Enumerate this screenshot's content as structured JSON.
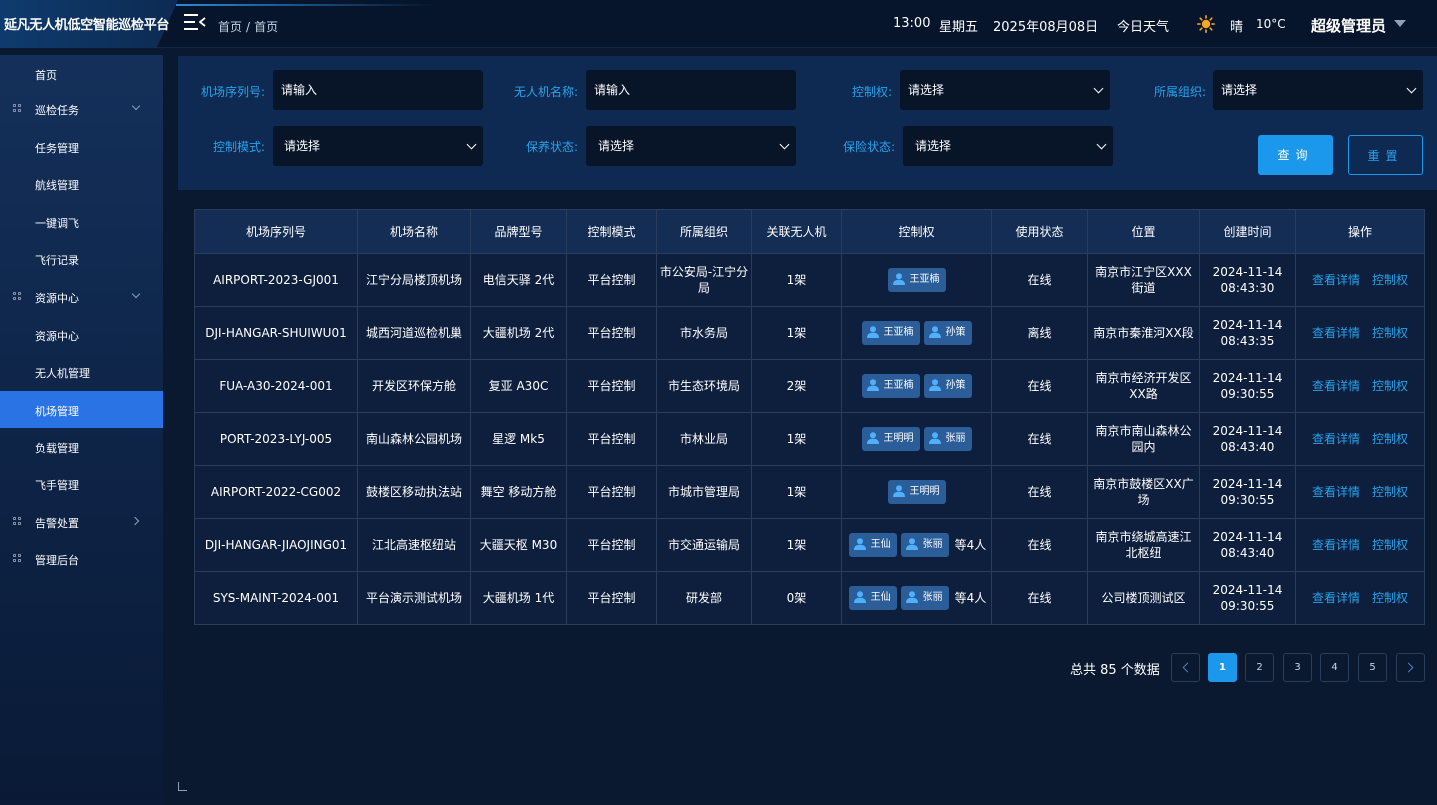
{
  "app": {
    "title": "延凡无人机低空智能巡检平台"
  },
  "breadcrumb": [
    "首页",
    "首页"
  ],
  "header": {
    "time": "13:00",
    "weekday": "星期五",
    "date": "2025年08月08日",
    "weather_label": "今日天气",
    "weather": "晴",
    "temp": "10°C",
    "user": "超级管理员"
  },
  "sidebar": {
    "items": [
      {
        "label": "首页",
        "level": 1
      },
      {
        "label": "巡检任务",
        "level": 0,
        "icon": "grid-icon",
        "chevron": "down"
      },
      {
        "label": "任务管理",
        "level": 1
      },
      {
        "label": "航线管理",
        "level": 1
      },
      {
        "label": "一键调飞",
        "level": 1
      },
      {
        "label": "飞行记录",
        "level": 1
      },
      {
        "label": "资源中心",
        "level": 0,
        "icon": "grid-icon",
        "chevron": "down"
      },
      {
        "label": "资源中心",
        "level": 1
      },
      {
        "label": "无人机管理",
        "level": 1
      },
      {
        "label": "机场管理",
        "level": 1,
        "active": true
      },
      {
        "label": "负载管理",
        "level": 1
      },
      {
        "label": "飞手管理",
        "level": 1
      },
      {
        "label": "告警处置",
        "level": 0,
        "icon": "grid-icon",
        "chevron": "right"
      },
      {
        "label": "管理后台",
        "level": 0,
        "icon": "grid-icon"
      }
    ]
  },
  "filters": {
    "serial": {
      "label": "机场序列号:",
      "placeholder": "请输入"
    },
    "drone_name": {
      "label": "无人机名称:",
      "placeholder": "请输入"
    },
    "control": {
      "label": "控制权:",
      "value": "请选择"
    },
    "org": {
      "label": "所属组织:",
      "value": "请选择"
    },
    "mode": {
      "label": "控制模式:",
      "value": "请选择"
    },
    "maintain": {
      "label": "保养状态:",
      "value": "请选择"
    },
    "insurance": {
      "label": "保险状态:",
      "value": "请选择"
    },
    "query_label": "查询",
    "reset_label": "重置"
  },
  "table": {
    "columns": [
      "机场序列号",
      "机场名称",
      "品牌型号",
      "控制模式",
      "所属组织",
      "关联无人机",
      "控制权",
      "使用状态",
      "位置",
      "创建时间",
      "操作"
    ],
    "actions": {
      "detail": "查看详情",
      "control": "控制权"
    },
    "rows": [
      {
        "serial": "AIRPORT-2023-GJ001",
        "name": "江宁分局楼顶机场",
        "model": "电信天驿 2代",
        "mode": "平台控制",
        "org": "市公安局-江宁分局",
        "drones": "1架",
        "users": [
          "王亚楠"
        ],
        "more": "",
        "status": "在线",
        "status_type": "online",
        "location": "南京市江宁区XXX街道",
        "created": "2024-11-14 08:43:30"
      },
      {
        "serial": "DJI-HANGAR-SHUIWU01",
        "name": "城西河道巡检机巢",
        "model": "大疆机场 2代",
        "mode": "平台控制",
        "org": "市水务局",
        "drones": "1架",
        "users": [
          "王亚楠",
          "孙策"
        ],
        "more": "",
        "status": "离线",
        "status_type": "offline",
        "location": "南京市秦淮河XX段",
        "created": "2024-11-14 08:43:35"
      },
      {
        "serial": "FUA-A30-2024-001",
        "name": "开发区环保方舱",
        "model": "复亚 A30C",
        "mode": "平台控制",
        "org": "市生态环境局",
        "drones": "2架",
        "users": [
          "王亚楠",
          "孙策"
        ],
        "more": "",
        "status": "在线",
        "status_type": "online",
        "location": "南京市经济开发区XX路",
        "created": "2024-11-14 09:30:55"
      },
      {
        "serial": "PORT-2023-LYJ-005",
        "name": "南山森林公园机场",
        "model": "星逻 Mk5",
        "mode": "平台控制",
        "org": "市林业局",
        "drones": "1架",
        "users": [
          "王明明",
          "张丽"
        ],
        "more": "",
        "status": "在线",
        "status_type": "online",
        "location": "南京市南山森林公园内",
        "created": "2024-11-14 08:43:40"
      },
      {
        "serial": "AIRPORT-2022-CG002",
        "name": "鼓楼区移动执法站",
        "model": "舞空 移动方舱",
        "mode": "平台控制",
        "org": "市城市管理局",
        "drones": "1架",
        "users": [
          "王明明"
        ],
        "more": "",
        "status": "在线",
        "status_type": "online",
        "location": "南京市鼓楼区XX广场",
        "created": "2024-11-14 09:30:55"
      },
      {
        "serial": "DJI-HANGAR-JIAOJING01",
        "name": "江北高速枢纽站",
        "model": "大疆天枢 M30",
        "mode": "平台控制",
        "org": "市交通运输局",
        "drones": "1架",
        "users": [
          "王仙",
          "张丽"
        ],
        "more": "等4人",
        "status": "在线",
        "status_type": "online",
        "location": "南京市绕城高速江北枢纽",
        "created": "2024-11-14 08:43:40"
      },
      {
        "serial": "SYS-MAINT-2024-001",
        "name": "平台演示测试机场",
        "model": "大疆机场 1代",
        "mode": "平台控制",
        "org": "研发部",
        "drones": "0架",
        "users": [
          "王仙",
          "张丽"
        ],
        "more": "等4人",
        "status": "在线",
        "status_type": "online",
        "location": "公司楼顶测试区",
        "created": "2024-11-14 09:30:55"
      }
    ]
  },
  "pagination": {
    "total_text": "总共 85 个数据",
    "pages": [
      "1",
      "2",
      "3",
      "4",
      "5"
    ],
    "current": "1"
  }
}
